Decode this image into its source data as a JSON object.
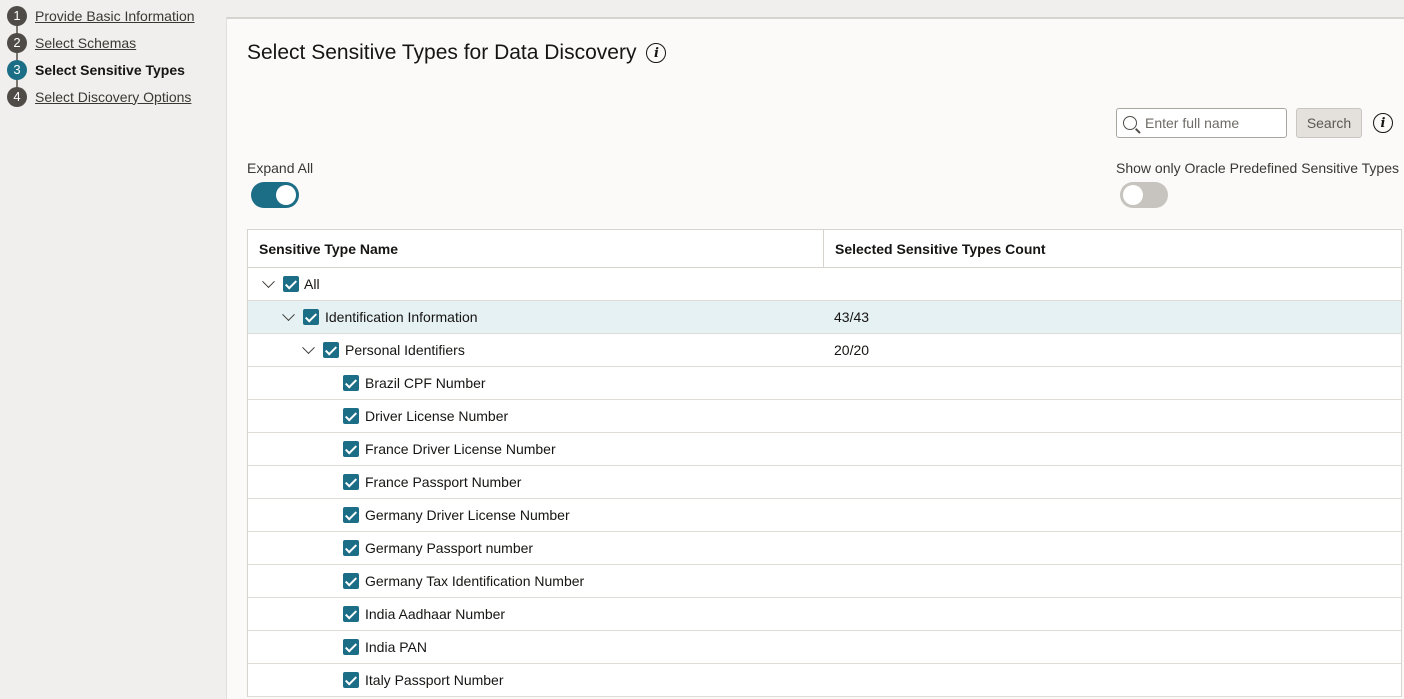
{
  "steps": [
    {
      "num": "1",
      "label": "Provide Basic Information"
    },
    {
      "num": "2",
      "label": "Select Schemas"
    },
    {
      "num": "3",
      "label": "Select Sensitive Types"
    },
    {
      "num": "4",
      "label": "Select Discovery Options"
    }
  ],
  "panel": {
    "title": "Select Sensitive Types for Data Discovery",
    "search_placeholder": "Enter full name",
    "search_button": "Search",
    "expand_all_label": "Expand All",
    "expand_all_on": true,
    "oracle_only_label": "Show only Oracle Predefined Sensitive Types",
    "oracle_only_on": false
  },
  "table": {
    "headers": [
      "Sensitive Type Name",
      "Selected Sensitive Types Count"
    ],
    "rows": [
      {
        "name": "All",
        "count": ""
      },
      {
        "name": "Identification Information",
        "count": "43/43"
      },
      {
        "name": "Personal Identifiers",
        "count": "20/20"
      },
      {
        "name": "Brazil CPF Number",
        "count": ""
      },
      {
        "name": "Driver License Number",
        "count": ""
      },
      {
        "name": "France Driver License Number",
        "count": ""
      },
      {
        "name": "France Passport Number",
        "count": ""
      },
      {
        "name": "Germany Driver License Number",
        "count": ""
      },
      {
        "name": "Germany Passport number",
        "count": ""
      },
      {
        "name": "Germany Tax Identification Number",
        "count": ""
      },
      {
        "name": "India Aadhaar Number",
        "count": ""
      },
      {
        "name": "India PAN",
        "count": ""
      },
      {
        "name": "Italy Passport Number",
        "count": ""
      }
    ]
  },
  "colors": {
    "accent": "#1c6d86",
    "highlight_row": "#e6f1f3"
  }
}
